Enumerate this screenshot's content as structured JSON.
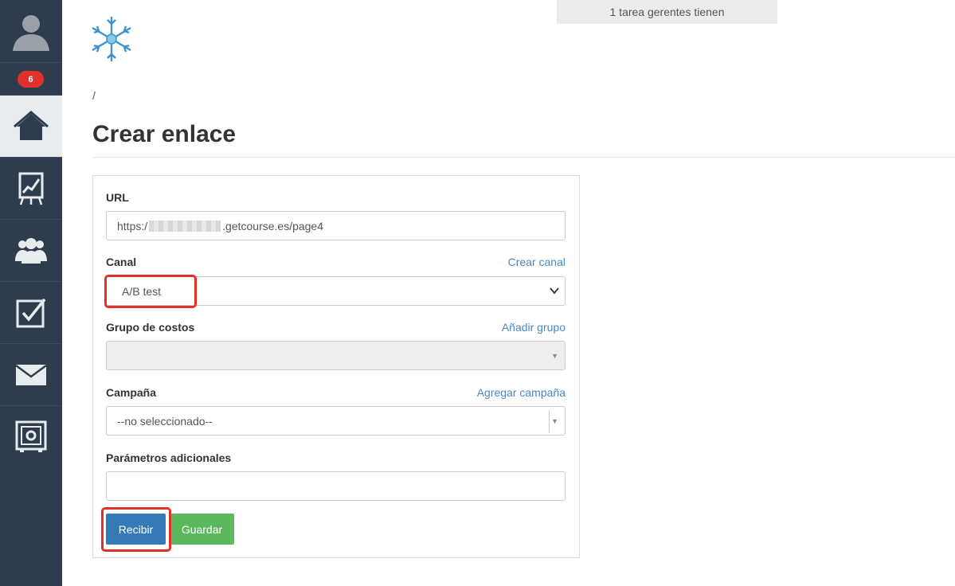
{
  "sidebar": {
    "notification_count": "6",
    "items": [
      {
        "icon": "home-icon",
        "active": true
      },
      {
        "icon": "chart-board-icon"
      },
      {
        "icon": "users-icon"
      },
      {
        "icon": "checkbox-icon"
      },
      {
        "icon": "mail-icon"
      },
      {
        "icon": "safe-settings-icon"
      }
    ]
  },
  "header": {
    "tasks_info": "1 tarea gerentes tienen",
    "breadcrumb": "/",
    "title": "Crear enlace"
  },
  "form": {
    "url_label": "URL",
    "url_prefix": "https:/",
    "url_suffix": ".getcourse.es/page4",
    "canal_label": "Canal",
    "canal_link": "Crear canal",
    "canal_value": "A/B test",
    "grupo_label": "Grupo de costos",
    "grupo_link": "Añadir grupo",
    "campana_label": "Campaña",
    "campana_link": "Agregar campaña",
    "campana_value": "--no seleccionado--",
    "params_label": "Parámetros adicionales",
    "params_value": "",
    "recibir_label": "Recibir",
    "guardar_label": "Guardar"
  },
  "colors": {
    "sidebar": "#2e3c4e",
    "primary": "#337ab7",
    "success": "#5cb85c",
    "highlight": "#e0302a",
    "link": "#4a86c7"
  }
}
